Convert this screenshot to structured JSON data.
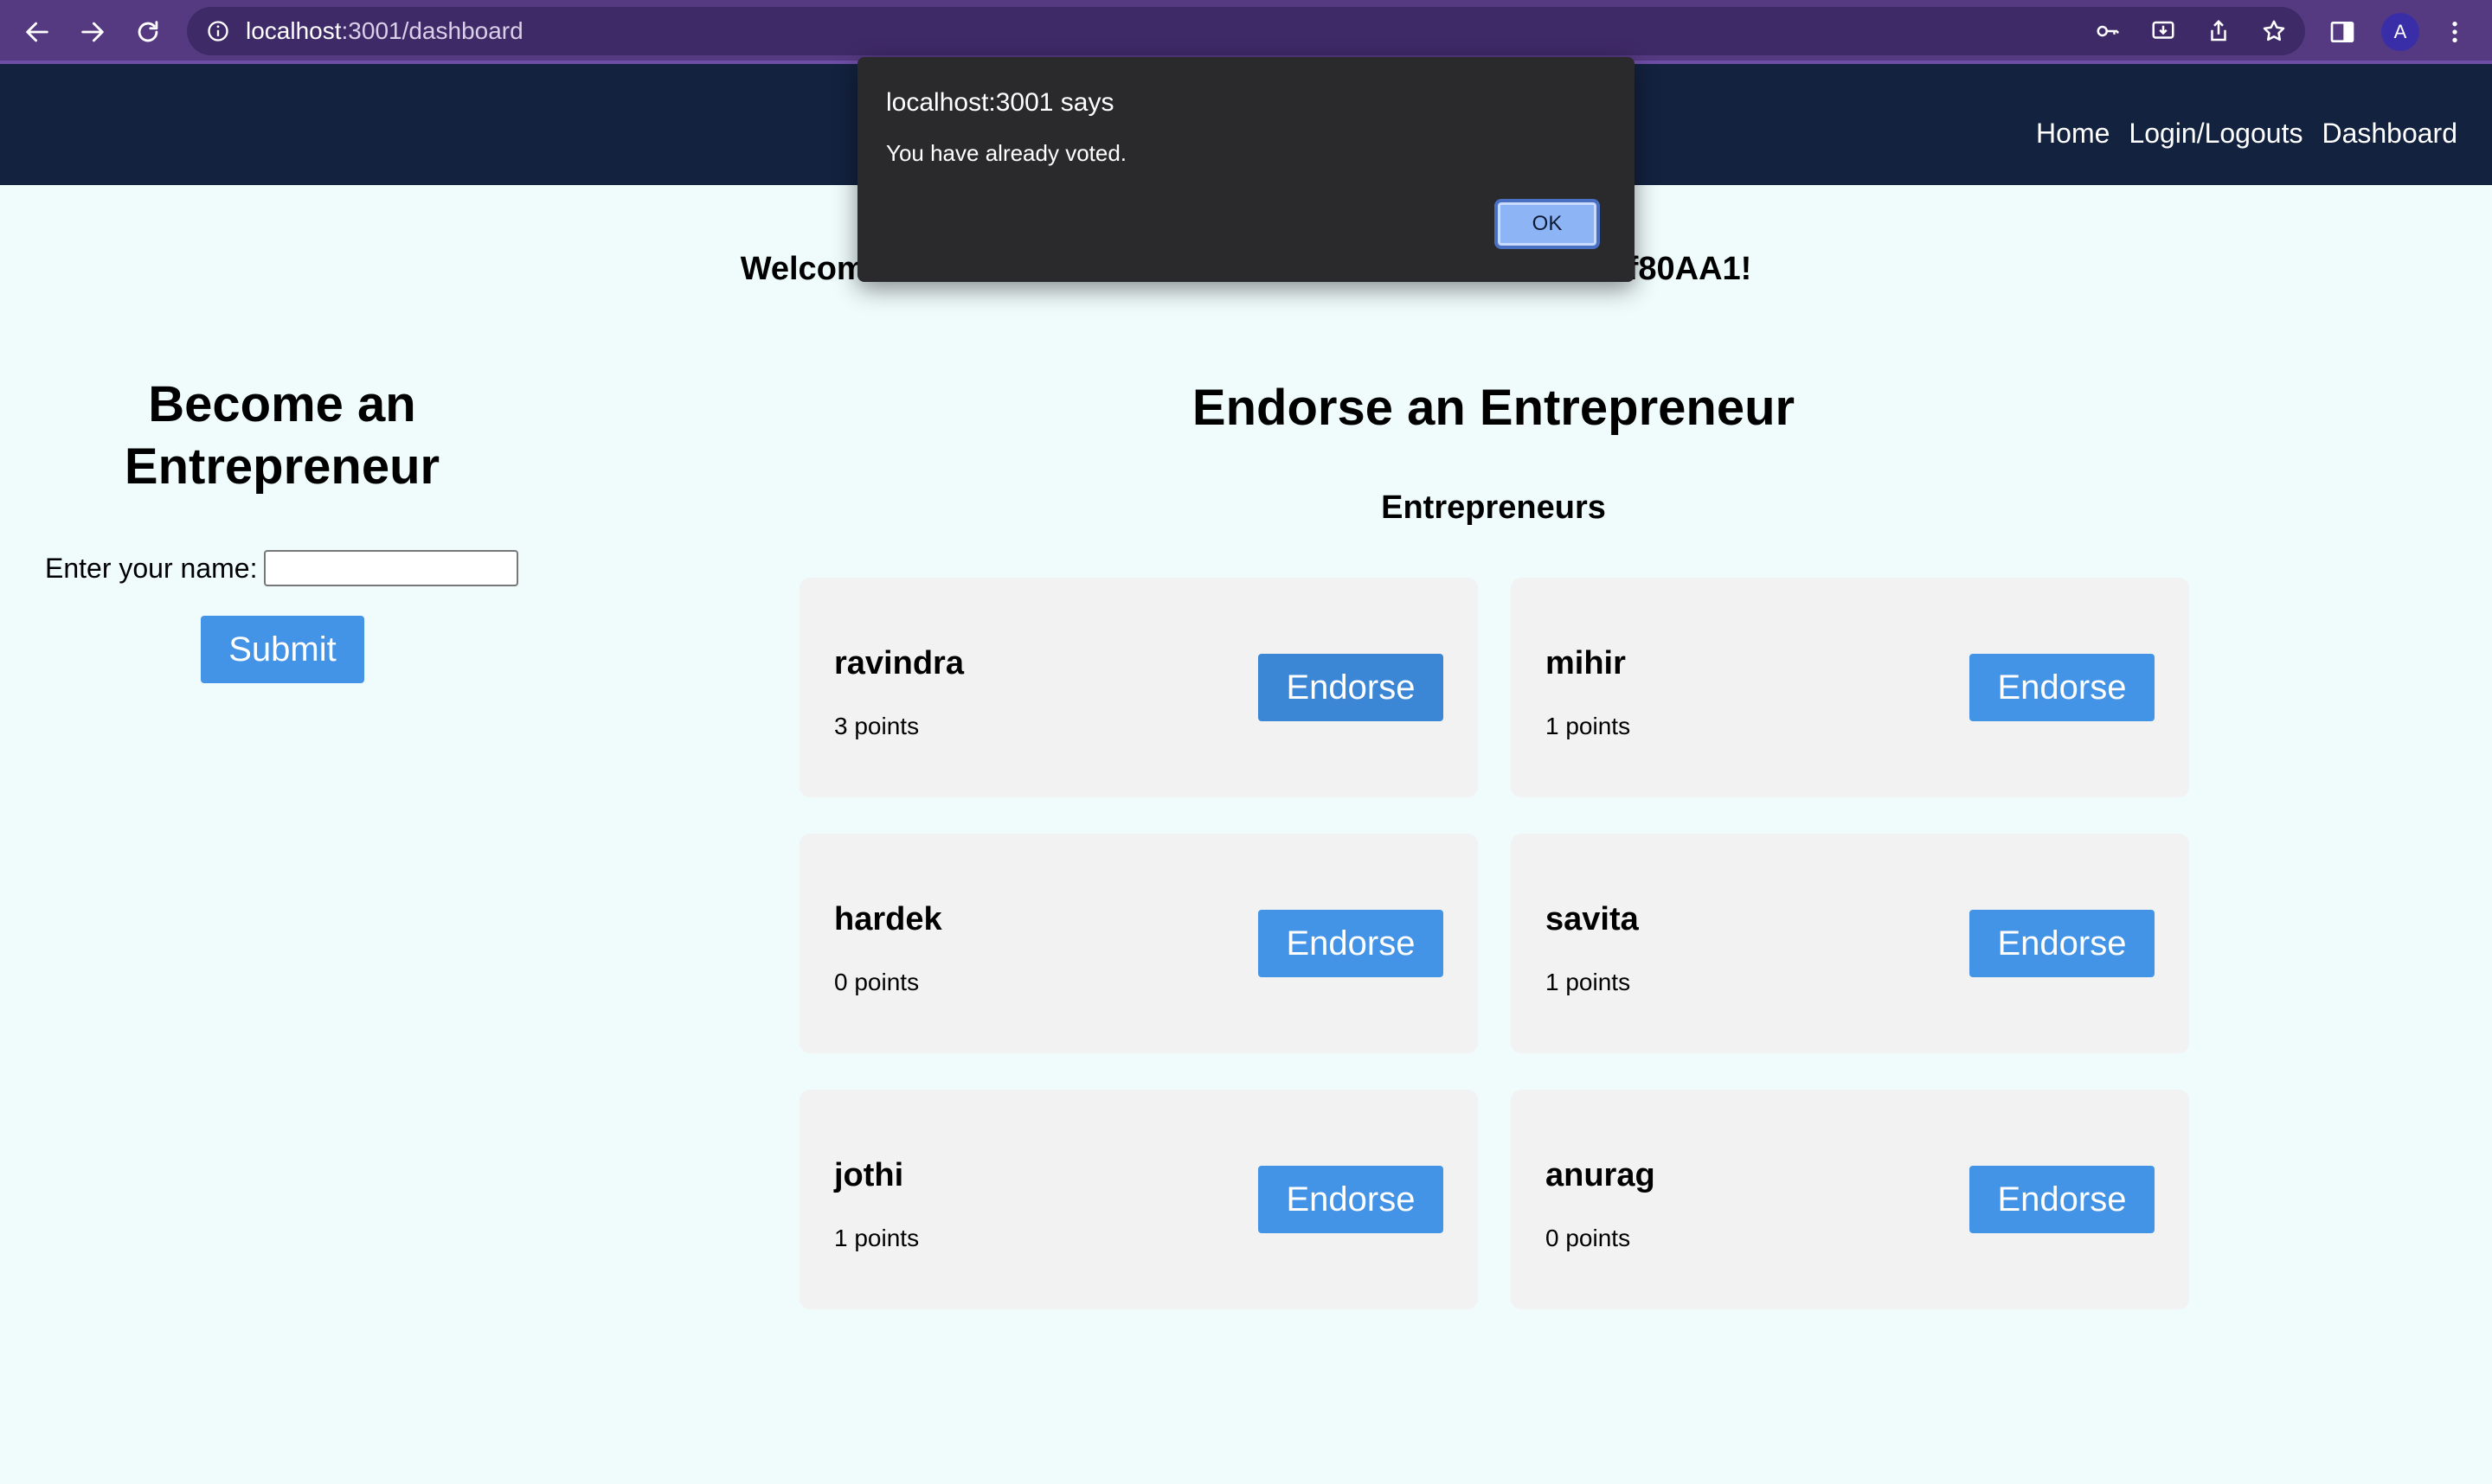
{
  "browser": {
    "url_host": "localhost",
    "url_path": ":3001/dashboard",
    "avatar_letter": "A",
    "icons": [
      "back-arrow-icon",
      "forward-arrow-icon",
      "reload-icon",
      "info-icon",
      "key-icon",
      "install-icon",
      "share-icon",
      "star-icon",
      "side-panel-icon",
      "more-icon"
    ]
  },
  "header": {
    "nav": [
      "Home",
      "Login/Logouts",
      "Dashboard"
    ]
  },
  "welcome": {
    "start": "Welcom",
    "end": "f80AA1!"
  },
  "become": {
    "title_line1": "Become an",
    "title_line2": "Entrepreneur",
    "name_label": "Enter your name:",
    "name_value": "",
    "submit_label": "Submit"
  },
  "endorse": {
    "title": "Endorse an Entrepreneur",
    "subtitle": "Entrepreneurs",
    "button_label": "Endorse",
    "cards": [
      {
        "name": "ravindra",
        "points": "3 points"
      },
      {
        "name": "mihir",
        "points": "1 points"
      },
      {
        "name": "hardek",
        "points": "0 points"
      },
      {
        "name": "savita",
        "points": "1 points"
      },
      {
        "name": "jothi",
        "points": "1 points"
      },
      {
        "name": "anurag",
        "points": "0 points"
      }
    ]
  },
  "dialog": {
    "title": "localhost:3001 says",
    "message": "You have already voted.",
    "ok_label": "OK"
  },
  "colors": {
    "browser_bar": "#553a82",
    "app_header": "#13223f",
    "page_bg": "#f0fcfc",
    "button_blue": "#4393e6",
    "card_bg": "#f2f2f2"
  }
}
